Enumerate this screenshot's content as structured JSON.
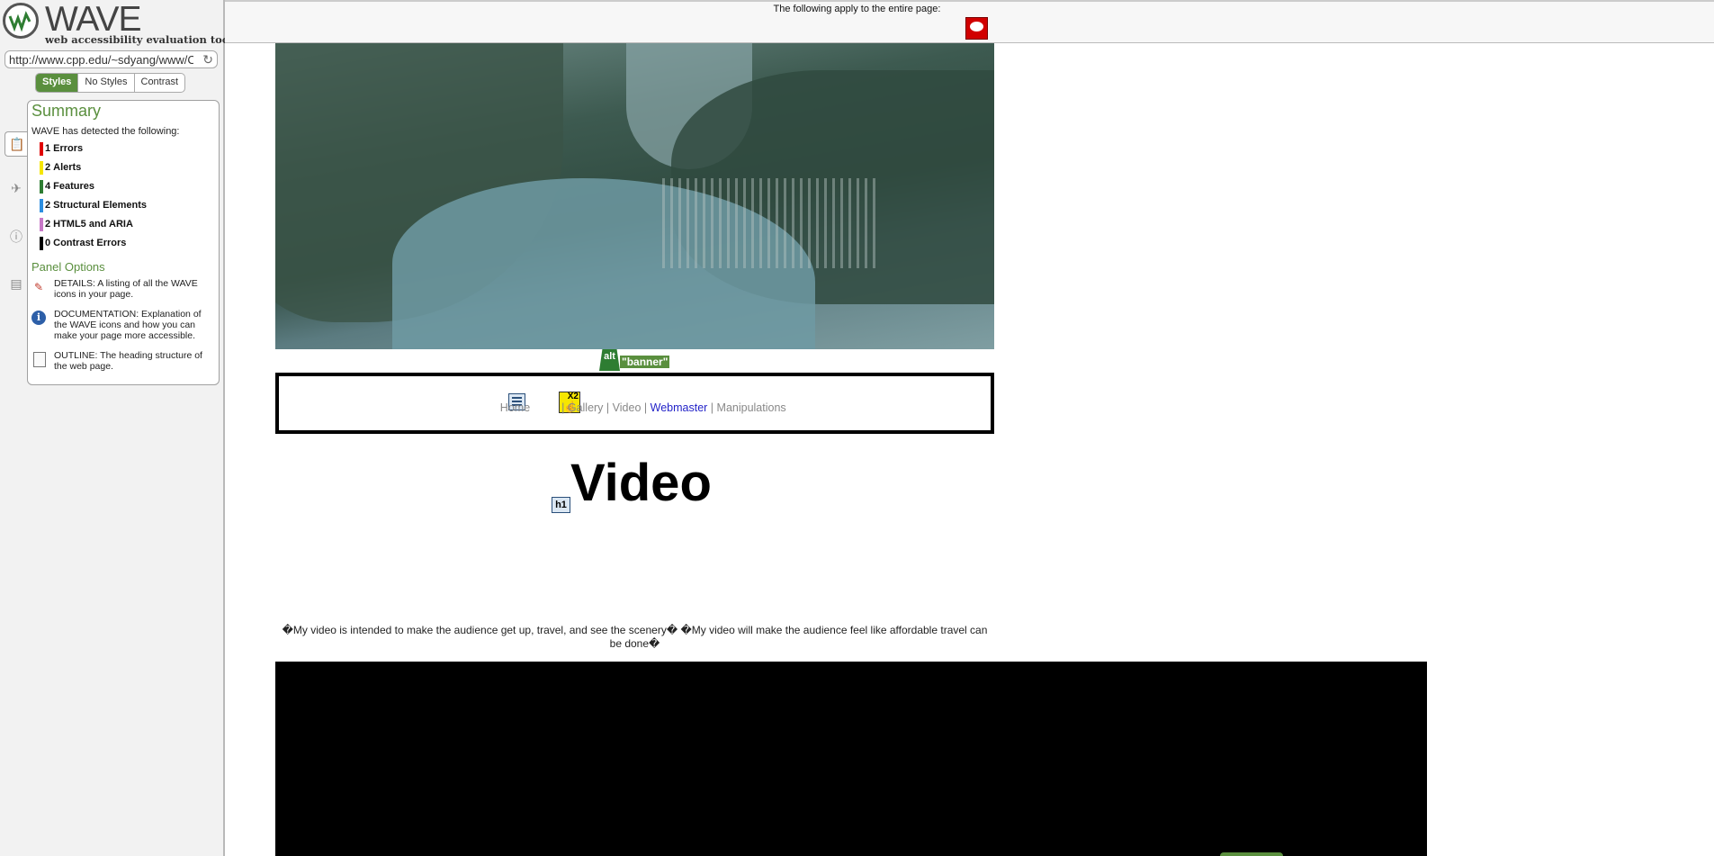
{
  "wave": {
    "logo_word": "WAVE",
    "logo_tagline": "web accessibility evaluation tool",
    "url": "http://www.cpp.edu/~sdyang/www/C",
    "modes": [
      "Styles",
      "No Styles",
      "Contrast"
    ],
    "active_mode": "Styles",
    "summary_title": "Summary",
    "detected_text": "WAVE has detected the following:",
    "summary": [
      {
        "count": "1",
        "label": "Errors",
        "color": "#e00000"
      },
      {
        "count": "2",
        "label": "Alerts",
        "color": "#f6e600"
      },
      {
        "count": "4",
        "label": "Features",
        "color": "#2e7d32"
      },
      {
        "count": "2",
        "label": "Structural Elements",
        "color": "#2d8ee0"
      },
      {
        "count": "2",
        "label": "HTML5 and ARIA",
        "color": "#c879c8"
      },
      {
        "count": "0",
        "label": "Contrast Errors",
        "color": "#000000"
      }
    ],
    "panel_options_title": "Panel Options",
    "options": [
      {
        "text": "DETAILS: A listing of all the WAVE icons in your page.",
        "icon": "details-icon"
      },
      {
        "text": "DOCUMENTATION: Explanation of the WAVE icons and how you can make your page more accessible.",
        "icon": "info-icon"
      },
      {
        "text": "OUTLINE: The heading structure of the web page.",
        "icon": "outline-icon"
      }
    ]
  },
  "report": {
    "topbar_text": "The following apply to the entire page:"
  },
  "page": {
    "alt_icon": "alt",
    "alt_text": "\"banner\"",
    "nav": {
      "home": "Home",
      "x2_label": "X2",
      "gallery": "Gallery",
      "video": "Video",
      "webmaster": "Webmaster",
      "manipulations": "Manipulations",
      "separator": "|"
    },
    "h1_icon": "h1",
    "title": "Video",
    "intro": "�My video is intended to make the audience get up, travel, and see the scenery� �My video will make the audience feel like affordable travel can be done�"
  }
}
